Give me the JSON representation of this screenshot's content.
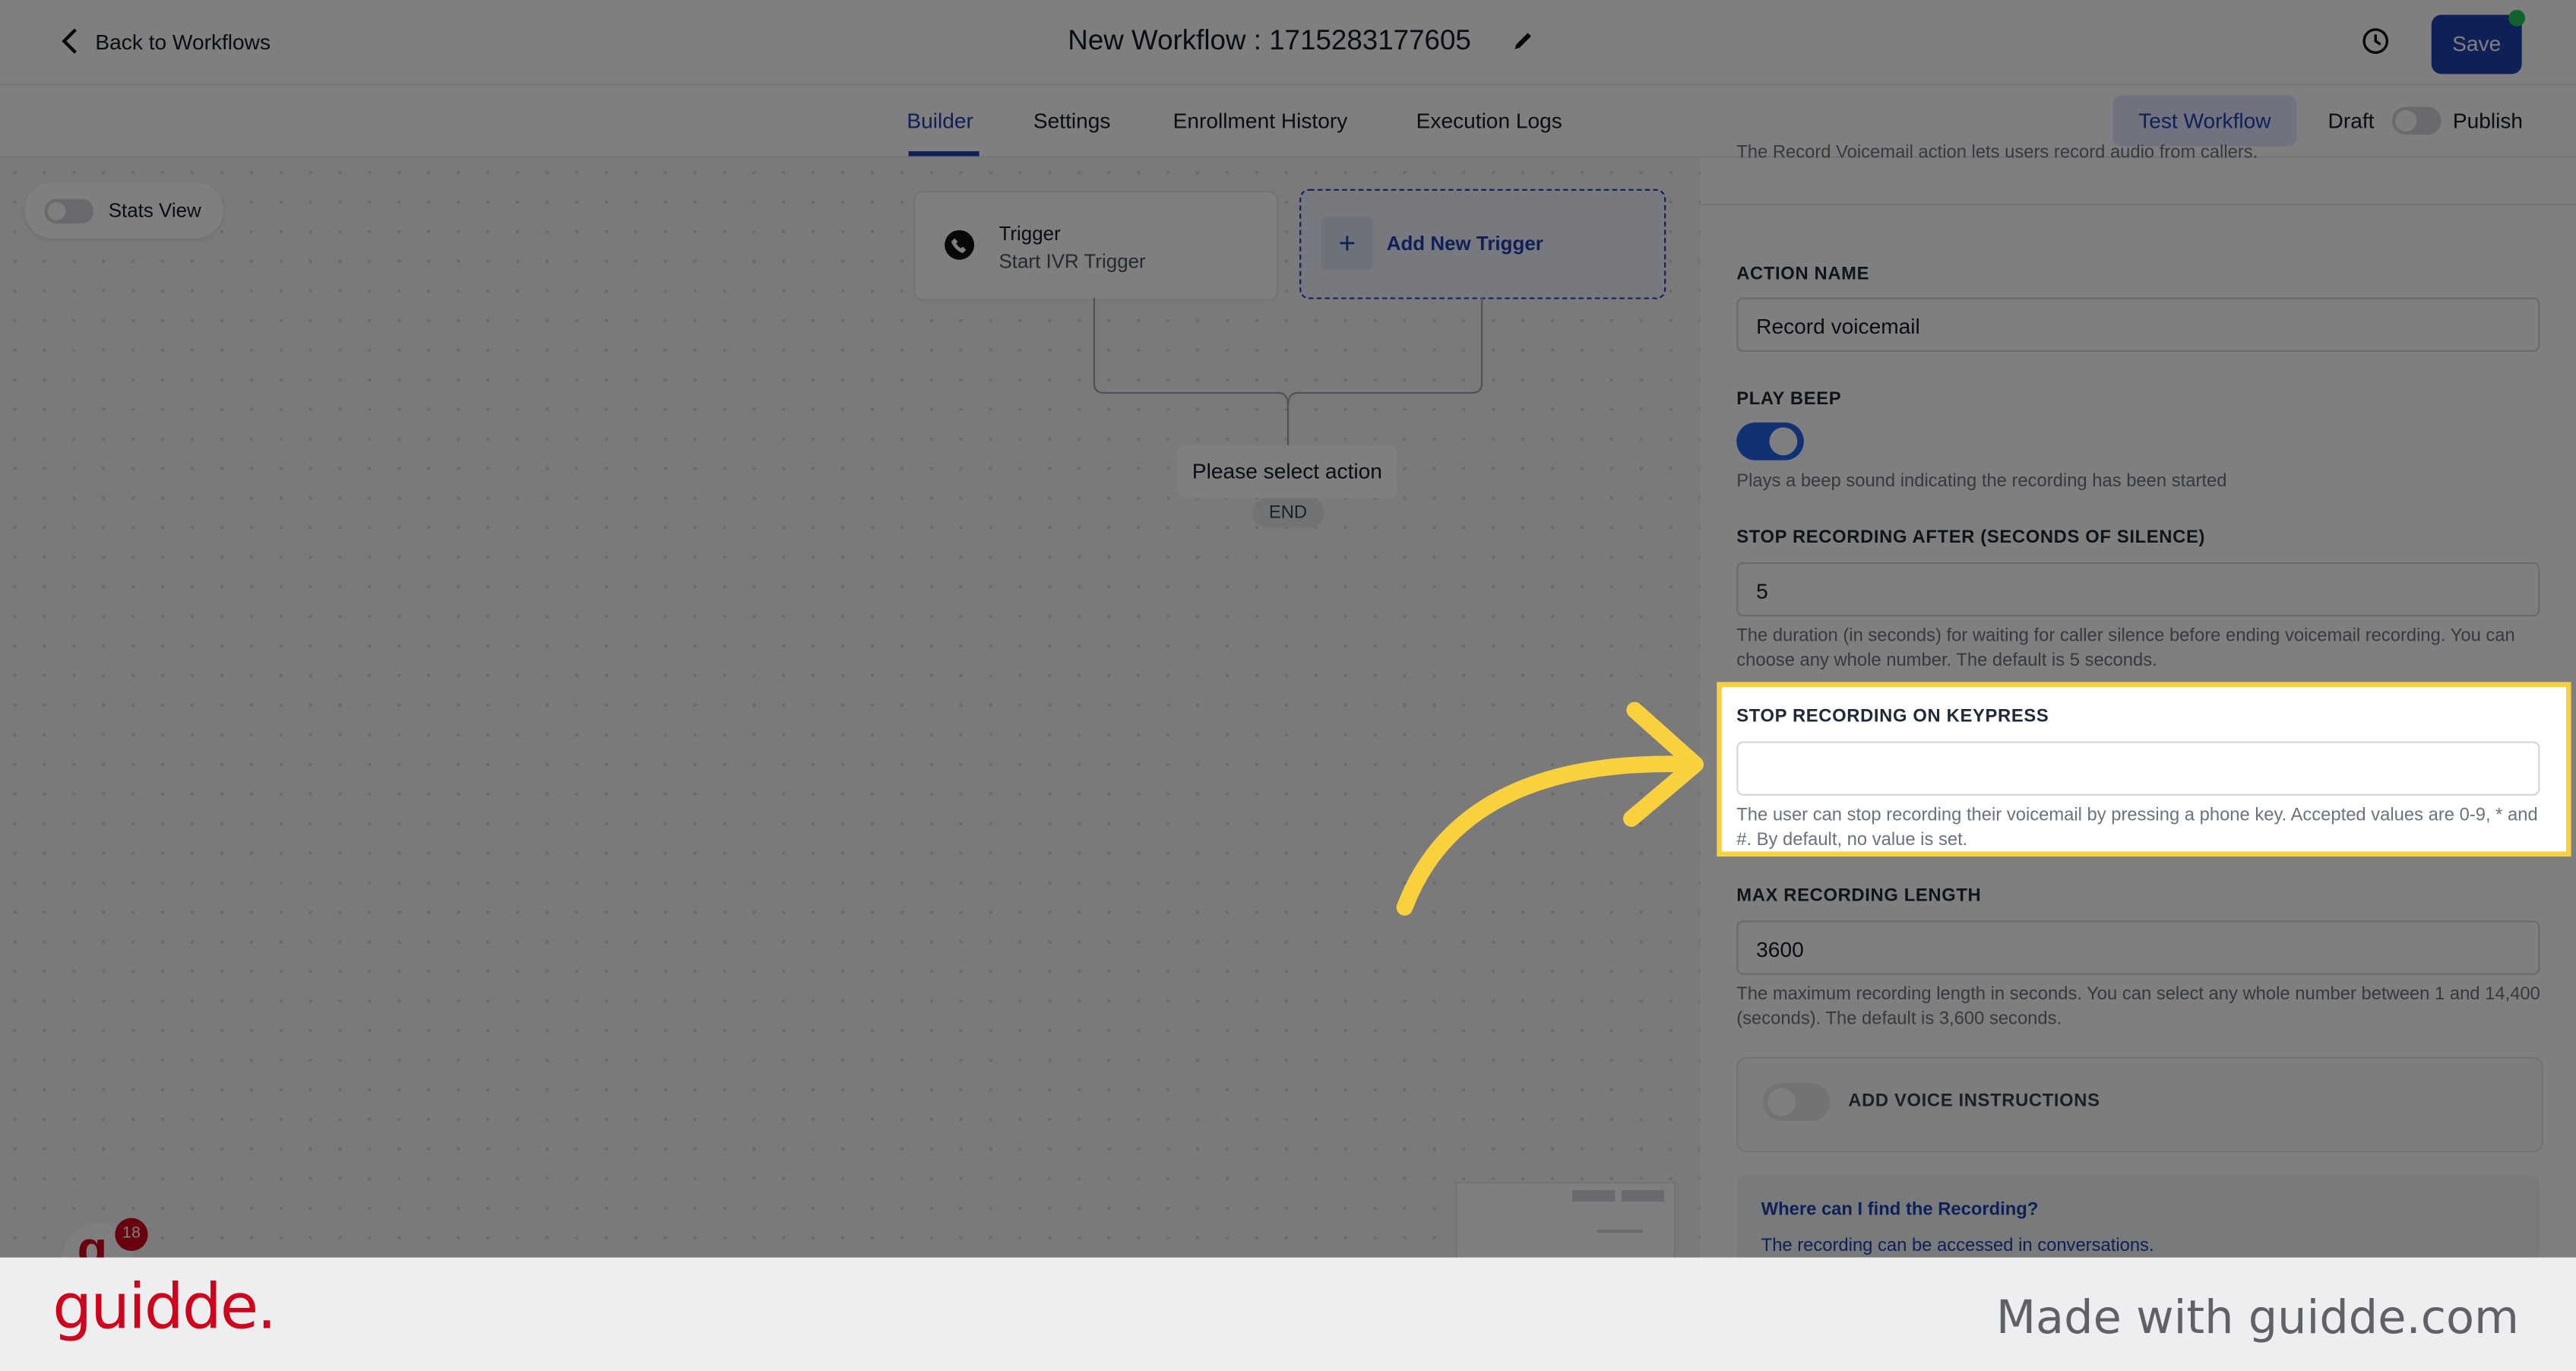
{
  "header": {
    "back_label": "Back to Workflows",
    "title": "New Workflow : 1715283177605",
    "save_label": "Save"
  },
  "tabs": [
    {
      "label": "Builder",
      "active": true
    },
    {
      "label": "Settings"
    },
    {
      "label": "Enrollment History"
    },
    {
      "label": "Execution Logs"
    }
  ],
  "toolbar": {
    "test_label": "Test Workflow",
    "draft_label": "Draft",
    "publish_label": "Publish",
    "published": false
  },
  "canvas": {
    "stats_view_label": "Stats View",
    "trigger": {
      "title": "Trigger",
      "subtitle": "Start IVR Trigger"
    },
    "add_trigger_label": "Add New Trigger",
    "select_action_label": "Please select action",
    "end_label": "END",
    "notification_count": "18"
  },
  "panel": {
    "intro": "The Record Voicemail action lets users record audio from callers.",
    "action_name": {
      "label": "ACTION NAME",
      "value": "Record voicemail"
    },
    "play_beep": {
      "label": "PLAY BEEP",
      "enabled": true,
      "help": "Plays a beep sound indicating the recording has been started"
    },
    "stop_after": {
      "label": "STOP RECORDING AFTER (SECONDS OF SILENCE)",
      "value": "5",
      "help": "The duration (in seconds) for waiting for caller silence before ending voicemail recording. You can choose any whole number. The default is 5 seconds."
    },
    "stop_keypress": {
      "label": "STOP RECORDING ON KEYPRESS",
      "value": "",
      "help": "The user can stop recording their voicemail by pressing a phone key. Accepted values are 0-9, * and #. By default, no value is set."
    },
    "max_length": {
      "label": "MAX RECORDING LENGTH",
      "value": "3600",
      "help": "The maximum recording length in seconds. You can select any whole number between 1 and 14,400 (seconds). The default is 3,600 seconds."
    },
    "voice_instructions": {
      "label": "ADD VOICE INSTRUCTIONS",
      "enabled": false
    },
    "faq": {
      "question": "Where can I find the Recording?",
      "answer": "The recording can be accessed in conversations."
    }
  },
  "colors": {
    "accent": "#1e40af",
    "highlight": "#f9d13e",
    "brand": "#d0021b"
  },
  "footer": {
    "logo": "guidde.",
    "tagline": "Made with guidde.com"
  }
}
